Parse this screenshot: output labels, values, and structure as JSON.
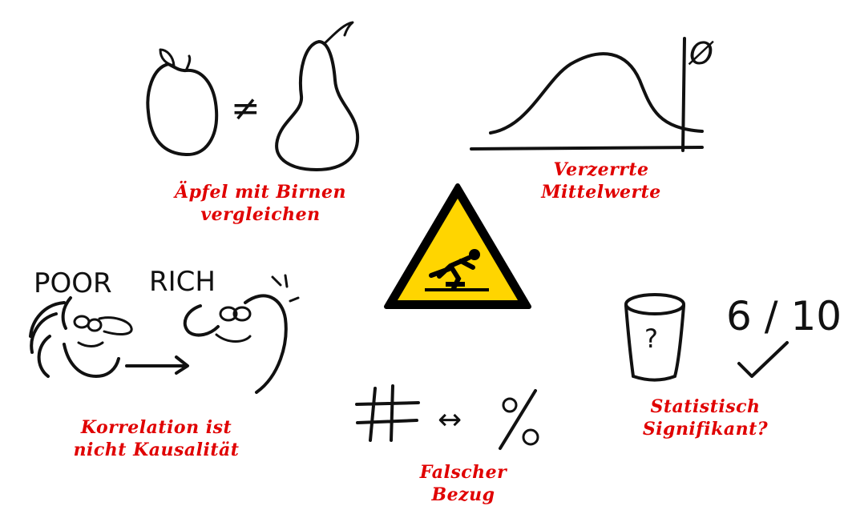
{
  "panels": {
    "apples": {
      "caption_line1": "Äpfel mit Birnen",
      "caption_line2": "vergleichen",
      "symbol": "≠"
    },
    "means": {
      "caption_line1": "Verzerrte",
      "caption_line2": "Mittelwerte",
      "symbol": "Ø"
    },
    "correlation": {
      "caption_line1": "Korrelation ist",
      "caption_line2": "nicht Kausalität",
      "left_label": "POOR",
      "right_label": "RICH"
    },
    "reference": {
      "caption_line1": "Falscher",
      "caption_line2": "Bezug",
      "left_symbol": "#",
      "arrow": "↔",
      "right_symbol": "%"
    },
    "significance": {
      "caption_line1": "Statistisch",
      "caption_line2": "Signifikant?",
      "score": "6 / 10",
      "cup_mark": "?"
    }
  },
  "center_icon": "warning-trip-hazard-icon",
  "colors": {
    "caption": "#e00000",
    "ink": "#111111",
    "warning_fill": "#ffd500",
    "warning_border": "#000000"
  }
}
